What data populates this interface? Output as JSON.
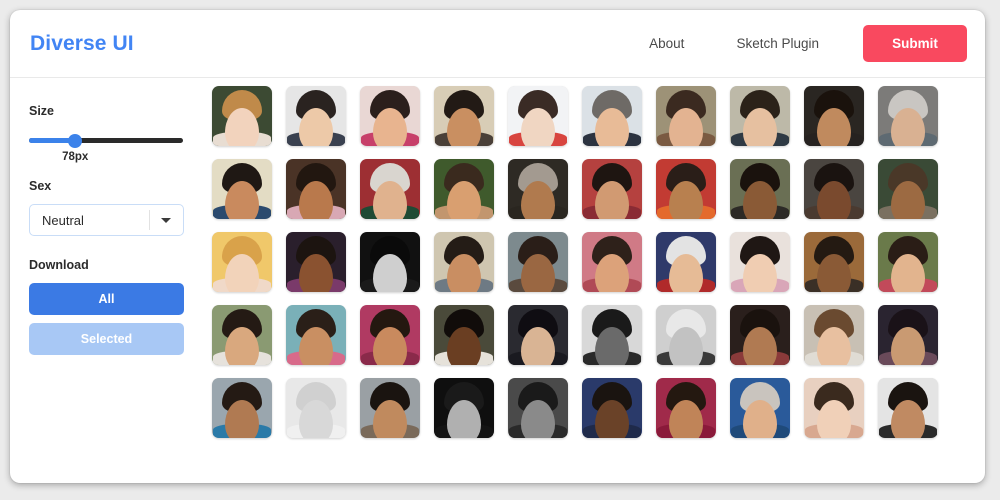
{
  "header": {
    "brand": "Diverse UI",
    "nav_links": [
      {
        "label": "About"
      },
      {
        "label": "Sketch Plugin"
      }
    ],
    "submit_label": "Submit",
    "submit_color": "#f9495f",
    "brand_color": "#4285f4"
  },
  "sidebar": {
    "size": {
      "label": "Size",
      "value_text": "78px",
      "percent": 30,
      "fill_color": "#3b82ea",
      "track_color": "#2a2a2a"
    },
    "sex": {
      "label": "Sex",
      "selected": "Neutral",
      "options": [
        "Neutral"
      ],
      "border_color": "#c9ddf7"
    },
    "download": {
      "label": "Download",
      "all_label": "All",
      "selected_label": "Selected",
      "all_color": "#3b7ae4",
      "selected_color": "#a8c8f5"
    }
  },
  "grid": {
    "columns": 10,
    "rows": 5,
    "avatars": [
      {
        "bg": "#3c4a33",
        "hair": "#c08a4a",
        "skin": "#f2d3bd",
        "torso": "#e8ddd2"
      },
      {
        "bg": "#e6e6e6",
        "hair": "#2a2320",
        "skin": "#edc9a8",
        "torso": "#3a4150"
      },
      {
        "bg": "#e9d7d4",
        "hair": "#2b1f1c",
        "skin": "#e8b48f",
        "torso": "#c7406a"
      },
      {
        "bg": "#d8cdb6",
        "hair": "#221a15",
        "skin": "#c98f61",
        "torso": "#4a4038"
      },
      {
        "bg": "#f2f3f5",
        "hair": "#3a2b25",
        "skin": "#f0d6c2",
        "torso": "#d8453f"
      },
      {
        "bg": "#dbe1e6",
        "hair": "#6e6a66",
        "skin": "#e8bb97",
        "torso": "#2c3340"
      },
      {
        "bg": "#9d9277",
        "hair": "#3b2a20",
        "skin": "#e3b391",
        "torso": "#7a5a42"
      },
      {
        "bg": "#bdb9a8",
        "hair": "#2b2219",
        "skin": "#e6c0a0",
        "torso": "#2f3a44"
      },
      {
        "bg": "#2a2622",
        "hair": "#1a120c",
        "skin": "#c08a5e",
        "torso": "#262220"
      },
      {
        "bg": "#7c7b79",
        "hair": "#c9c6c2",
        "skin": "#d9b192",
        "torso": "#5e6a72"
      },
      {
        "bg": "#e3dcc4",
        "hair": "#1f1814",
        "skin": "#c98a5e",
        "torso": "#2b4a6e"
      },
      {
        "bg": "#4a3326",
        "hair": "#221710",
        "skin": "#b9794c",
        "torso": "#d8a8b4"
      },
      {
        "bg": "#9d2f33",
        "hair": "#d9d5cf",
        "skin": "#e0b28e",
        "torso": "#1f4a34"
      },
      {
        "bg": "#3f5a2c",
        "hair": "#3a2a1e",
        "skin": "#d99f70",
        "torso": "#c2966e"
      },
      {
        "bg": "#2e2a24",
        "hair": "#a39a90",
        "skin": "#b07a4e",
        "torso": "#2a2620"
      },
      {
        "bg": "#b5413f",
        "hair": "#1e1511",
        "skin": "#d19a72",
        "torso": "#8a2b34"
      },
      {
        "bg": "#c23b33",
        "hair": "#2a1e18",
        "skin": "#b8804f",
        "torso": "#e46a2c"
      },
      {
        "bg": "#6a6f54",
        "hair": "#1a120d",
        "skin": "#8a5a36",
        "torso": "#2c2a26"
      },
      {
        "bg": "#4a4540",
        "hair": "#1a1310",
        "skin": "#7a4a2e",
        "torso": "#4a3a30"
      },
      {
        "bg": "#3a4a36",
        "hair": "#4a3828",
        "skin": "#9c6a42",
        "torso": "#7a7060"
      },
      {
        "bg": "#f0c86a",
        "hair": "#d9a24a",
        "skin": "#f2d3ba",
        "torso": "#f0d9c8"
      },
      {
        "bg": "#2a1f2c",
        "hair": "#1c1410",
        "skin": "#8a5230",
        "torso": "#7a3a6a"
      },
      {
        "bg": "#111111",
        "hair": "#0a0a0a",
        "skin": "#cfcfcf",
        "torso": "#1a1a1a"
      },
      {
        "bg": "#cfc6b0",
        "hair": "#241c16",
        "skin": "#c98e62",
        "torso": "#6e7a84"
      },
      {
        "bg": "#7d8a8e",
        "hair": "#2a1e18",
        "skin": "#9a6742",
        "torso": "#5a4a3e"
      },
      {
        "bg": "#d07a86",
        "hair": "#2e211a",
        "skin": "#dca27a",
        "torso": "#b04a56"
      },
      {
        "bg": "#2f3a6a",
        "hair": "#e3e3e3",
        "skin": "#e6bb96",
        "torso": "#b02a2a"
      },
      {
        "bg": "#e9e1dc",
        "hair": "#1f1714",
        "skin": "#f0cdb2",
        "torso": "#d9a6b8"
      },
      {
        "bg": "#9b6a3a",
        "hair": "#241a12",
        "skin": "#8a5a36",
        "torso": "#3a2f26"
      },
      {
        "bg": "#6a7a4a",
        "hair": "#2a1d16",
        "skin": "#e2b48e",
        "torso": "#c24a5a"
      },
      {
        "bg": "#8a9a72",
        "hair": "#241a14",
        "skin": "#d9a87e",
        "torso": "#e6e2dc"
      },
      {
        "bg": "#7ab0b8",
        "hair": "#2a1f18",
        "skin": "#c98f62",
        "torso": "#d86a8a"
      },
      {
        "bg": "#b03a62",
        "hair": "#241810",
        "skin": "#c98a5e",
        "torso": "#8a2a4a"
      },
      {
        "bg": "#4a4a3a",
        "hair": "#110c0a",
        "skin": "#6a3e22",
        "torso": "#e6e2da"
      },
      {
        "bg": "#2a2a30",
        "hair": "#0f0d12",
        "skin": "#d9b494",
        "torso": "#1a1a20"
      },
      {
        "bg": "#d8d8d8",
        "hair": "#1a1a1a",
        "skin": "#6a6a6a",
        "torso": "#2a2a2a"
      },
      {
        "bg": "#cfcfcf",
        "hair": "#e8e8e8",
        "skin": "#c2c2c2",
        "torso": "#3a3a3a"
      },
      {
        "bg": "#2a1f1c",
        "hair": "#1a120e",
        "skin": "#b07a52",
        "torso": "#8a3a3a"
      },
      {
        "bg": "#c8c0b4",
        "hair": "#6a4a30",
        "skin": "#e8c0a0",
        "torso": "#e0dcd4"
      },
      {
        "bg": "#2a2430",
        "hair": "#1a1218",
        "skin": "#c99a72",
        "torso": "#6a4a5a"
      },
      {
        "bg": "#9aa6ae",
        "hair": "#241a14",
        "skin": "#b07a52",
        "torso": "#2a7aa8"
      },
      {
        "bg": "#e8e8e8",
        "hair": "#d0d0d0",
        "skin": "#d8d8d8",
        "torso": "#f0f0f0"
      },
      {
        "bg": "#9aa0a4",
        "hair": "#1a1410",
        "skin": "#c08a5e",
        "torso": "#7a6a5a"
      },
      {
        "bg": "#0f0f0f",
        "hair": "#1a1a1a",
        "skin": "#b0b0b0",
        "torso": "#141414"
      },
      {
        "bg": "#4a4a4a",
        "hair": "#1a1a1a",
        "skin": "#8a8a8a",
        "torso": "#2a2a2a"
      },
      {
        "bg": "#2a3a6a",
        "hair": "#1a1410",
        "skin": "#6a4228",
        "torso": "#1f2a4a"
      },
      {
        "bg": "#a02a4a",
        "hair": "#241810",
        "skin": "#c08458",
        "torso": "#8a1a3a"
      },
      {
        "bg": "#2a5a9a",
        "hair": "#c9c4be",
        "skin": "#e0b08a",
        "torso": "#1f4a7a"
      },
      {
        "bg": "#e8d0c0",
        "hair": "#3a2a1e",
        "skin": "#f0d0b8",
        "torso": "#d8a890"
      },
      {
        "bg": "#e4e4e4",
        "hair": "#1a1410",
        "skin": "#c08a62",
        "torso": "#2a2a2a"
      }
    ]
  }
}
